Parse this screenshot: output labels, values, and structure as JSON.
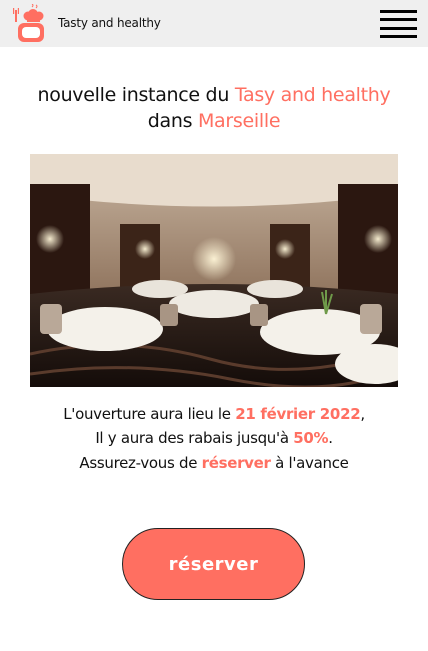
{
  "header": {
    "brand": "Tasty and healthy",
    "logo_icon": "chef-pot-icon",
    "menu_icon": "hamburger-menu-icon"
  },
  "hero": {
    "line1_prefix": "nouvelle instance du ",
    "line1_accent": "Tasy and healthy",
    "line2_prefix": "dans ",
    "line2_accent": "Marseille"
  },
  "info": {
    "opening_prefix": "L'ouverture aura lieu le ",
    "opening_date": "21 février 2022",
    "opening_suffix": ",",
    "discount_prefix": "Il y aura des rabais jusqu'à ",
    "discount_value": "50%",
    "discount_suffix": ".",
    "reserve_prefix": "Assurez-vous de ",
    "reserve_link": "réserver",
    "reserve_suffix": " à l'avance"
  },
  "cta": {
    "label": "réserver"
  },
  "colors": {
    "accent": "#ff6f61",
    "header_bg": "#efefef",
    "text": "#111111"
  }
}
